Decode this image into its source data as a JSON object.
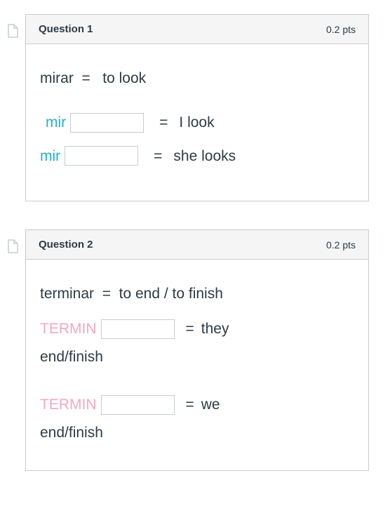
{
  "questions": [
    {
      "title": "Question 1",
      "pts": "0.2 pts",
      "prompt_left": "mirar",
      "prompt_eq": "=",
      "prompt_right": "to look",
      "rows": [
        {
          "stem": "mir",
          "eq": "=",
          "meaning": "I look"
        },
        {
          "stem": "mir",
          "eq": "=",
          "meaning": "she looks"
        }
      ]
    },
    {
      "title": "Question 2",
      "pts": "0.2 pts",
      "prompt_left": "terminar",
      "prompt_eq": "=",
      "prompt_right": "to end / to finish",
      "rows": [
        {
          "stem": "TERMIN",
          "eq": "=",
          "meaning_a": "they",
          "meaning_b": "end/finish"
        },
        {
          "stem": "TERMIN",
          "eq": "=",
          "meaning_a": "we",
          "meaning_b": "end/finish"
        }
      ]
    }
  ]
}
